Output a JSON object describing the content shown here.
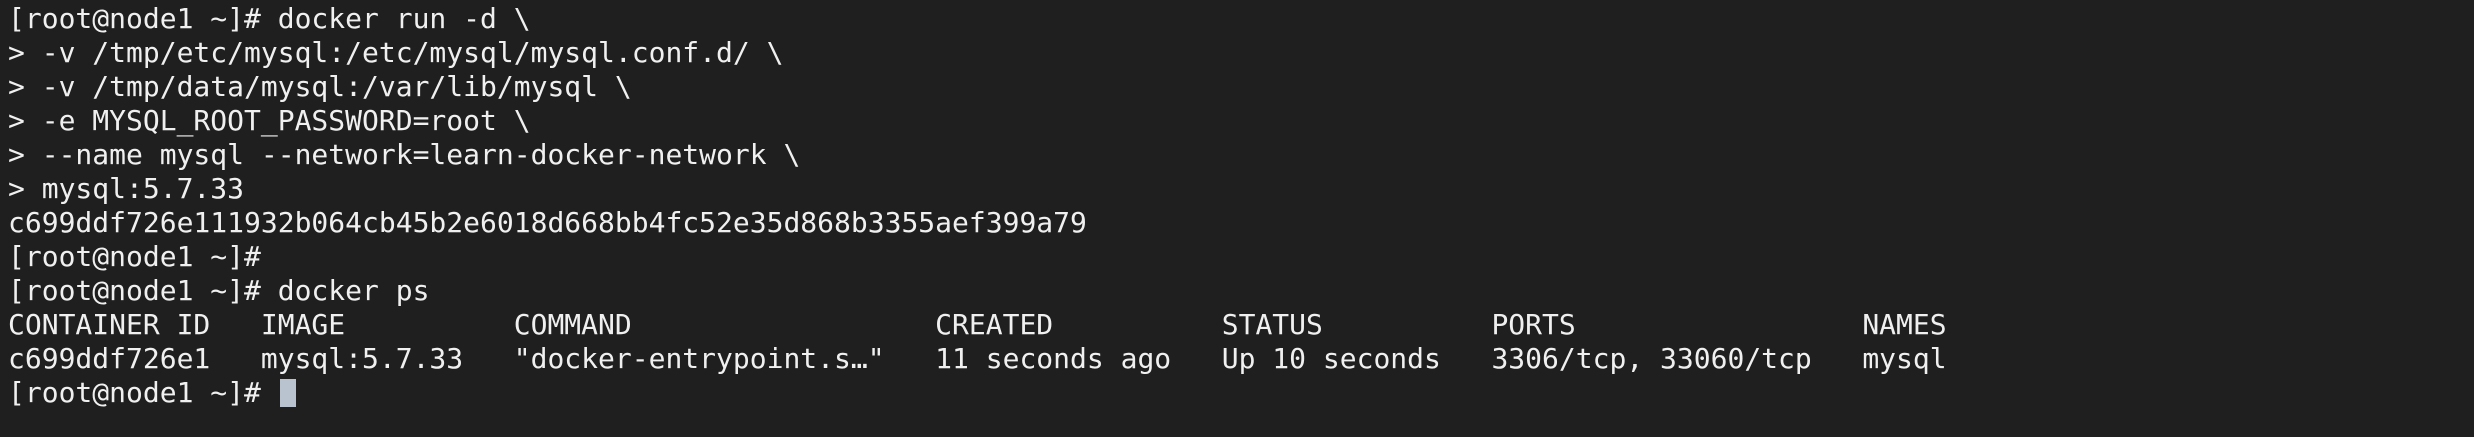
{
  "terminal": {
    "lines": [
      "[root@node1 ~]# docker run -d \\",
      "> -v /tmp/etc/mysql:/etc/mysql/mysql.conf.d/ \\",
      "> -v /tmp/data/mysql:/var/lib/mysql \\",
      "> -e MYSQL_ROOT_PASSWORD=root \\",
      "> --name mysql --network=learn-docker-network \\",
      "> mysql:5.7.33",
      "c699ddf726e111932b064cb45b2e6018d668bb4fc52e35d868b3355aef399a79",
      "[root@node1 ~]#",
      "[root@node1 ~]# docker ps",
      "CONTAINER ID   IMAGE          COMMAND                  CREATED          STATUS          PORTS                 NAMES",
      "c699ddf726e1   mysql:5.7.33   \"docker-entrypoint.s…\"   11 seconds ago   Up 10 seconds   3306/tcp, 33060/tcp   mysql",
      "[root@node1 ~]# "
    ]
  }
}
